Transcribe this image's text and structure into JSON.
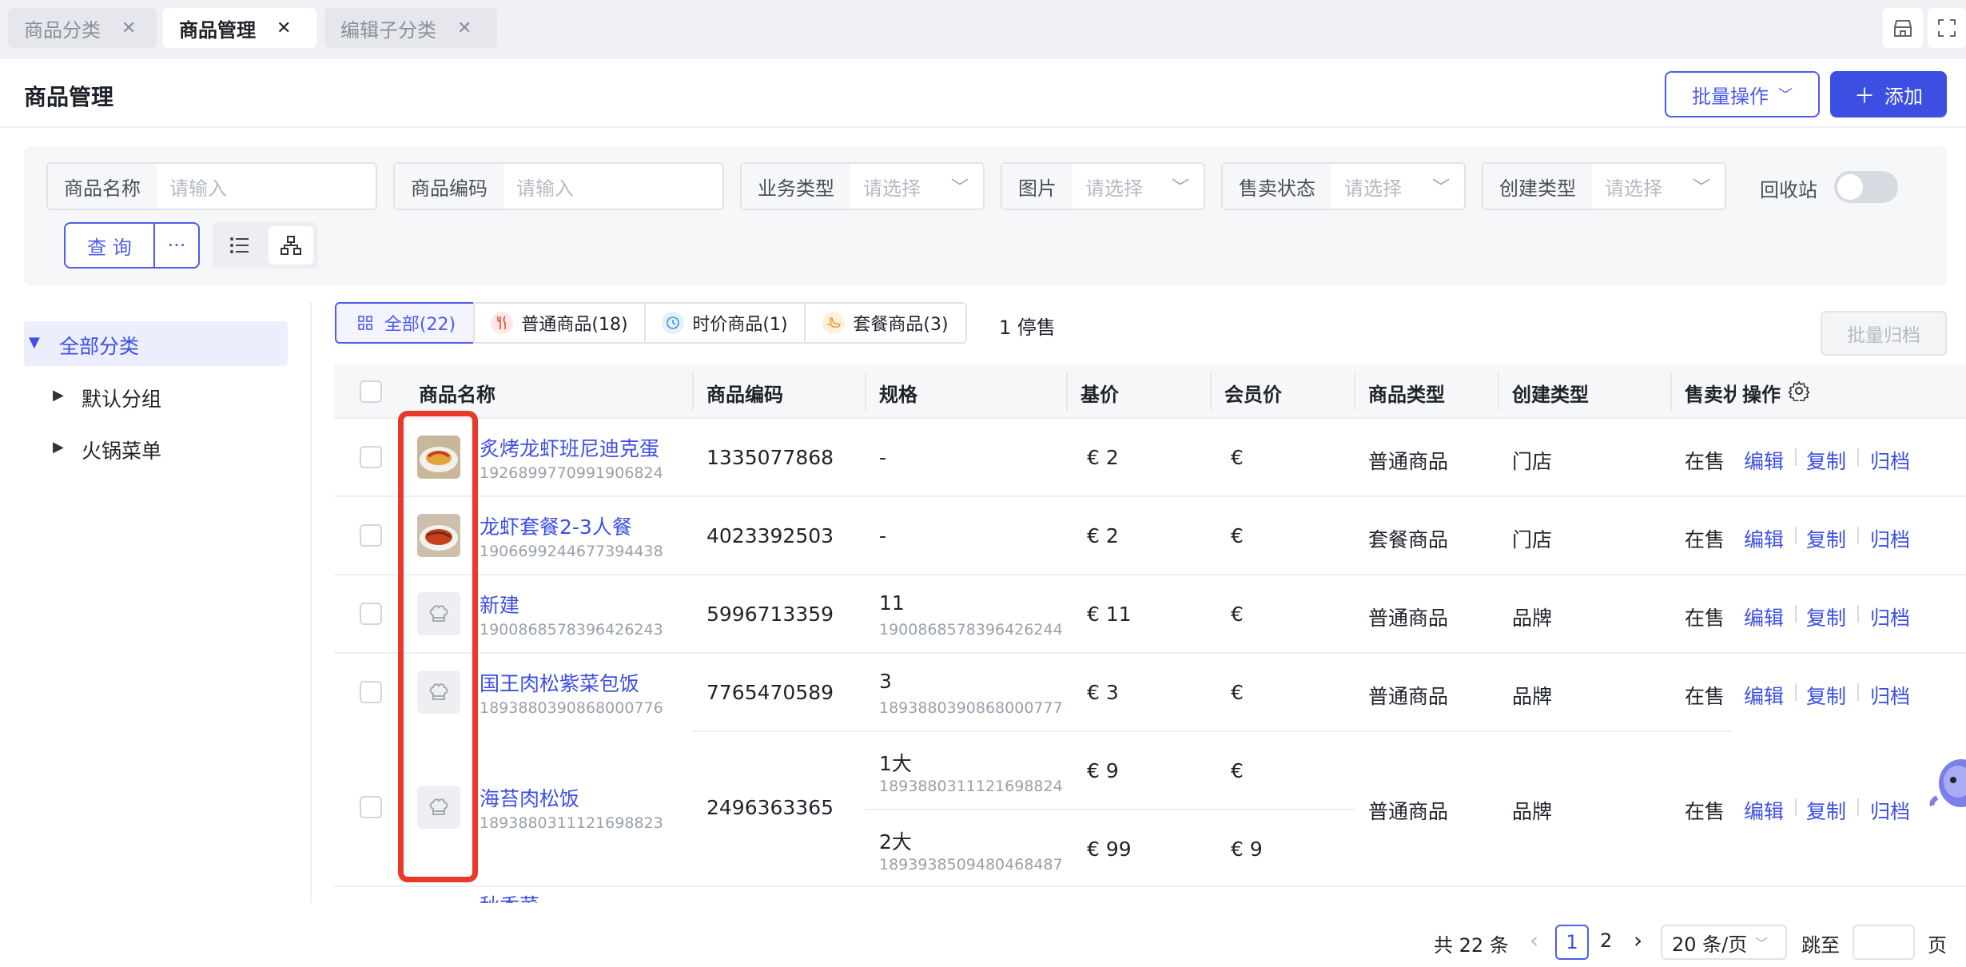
{
  "tabs": [
    {
      "label": "商品分类",
      "close": "✕"
    },
    {
      "label": "商品管理",
      "close": "✕"
    },
    {
      "label": "编辑子分类",
      "close": "✕"
    }
  ],
  "page": {
    "title": "商品管理",
    "batch_label": "批量操作",
    "add_label": "添加",
    "add_plus": "＋",
    "chevron": "﹀"
  },
  "filters": {
    "name": {
      "label": "商品名称",
      "placeholder": "请输入"
    },
    "code": {
      "label": "商品编码",
      "placeholder": "请输入"
    },
    "biz_type": {
      "label": "业务类型",
      "placeholder": "请选择"
    },
    "image": {
      "label": "图片",
      "placeholder": "请选择"
    },
    "sale_status": {
      "label": "售卖状态",
      "placeholder": "请选择"
    },
    "create_type": {
      "label": "创建类型",
      "placeholder": "请选择"
    },
    "recycle_label": "回收站",
    "recycle_on": false,
    "query_label": "查 询",
    "more_label": "···"
  },
  "tree": {
    "root": "全部分类",
    "children": [
      "默认分组",
      "火锅菜单"
    ]
  },
  "category_tabs": [
    {
      "label": "全部(22)",
      "icon": "grid-icon"
    },
    {
      "label": "普通商品(18)",
      "icon": "fork-knife-icon"
    },
    {
      "label": "时价商品(1)",
      "icon": "clock-icon"
    },
    {
      "label": "套餐商品(3)",
      "icon": "hand-icon"
    }
  ],
  "stopped_label": "1 停售",
  "batch_archive_label": "批量归档",
  "table": {
    "headers": [
      "商品名称",
      "商品编码",
      "规格",
      "基价",
      "会员价",
      "商品类型",
      "创建类型",
      "售卖状",
      "操作"
    ],
    "actions": [
      "编辑",
      "复制",
      "归档"
    ],
    "rows": [
      {
        "name": "炙烤龙虾班尼迪克蛋",
        "id": "1926899770991906824",
        "code": "1335077868",
        "spec": "-",
        "spec_id": "",
        "base": "€  2",
        "member": "€",
        "type": "普通商品",
        "create": "门店",
        "status": "在售"
      },
      {
        "name": "龙虾套餐2-3人餐",
        "id": "1906699244677394438",
        "code": "4023392503",
        "spec": "-",
        "spec_id": "",
        "base": "€  2",
        "member": "€",
        "type": "套餐商品",
        "create": "门店",
        "status": "在售"
      },
      {
        "name": "新建",
        "id": "1900868578396426243",
        "code": "5996713359",
        "spec": "11",
        "spec_id": "1900868578396426244",
        "base": "€  11",
        "member": "€",
        "type": "普通商品",
        "create": "品牌",
        "status": "在售"
      },
      {
        "name": "国王肉松紫菜包饭",
        "id": "1893880390868000776",
        "code": "7765470589",
        "spec": "3",
        "spec_id": "1893880390868000777",
        "base": "€  3",
        "member": "€",
        "type": "普通商品",
        "create": "品牌",
        "status": "在售"
      },
      {
        "name": "海苔肉松饭",
        "id": "1893880311121698823",
        "code": "2496363365",
        "spec": "1大",
        "spec_id": "1893880311121698824",
        "base": "€  9",
        "member": "€",
        "spec2": "2大",
        "spec2_id": "1893938509480468487",
        "base2": "€  99",
        "member2": "€  9",
        "type": "普通商品",
        "create": "品牌",
        "status": "在售"
      }
    ],
    "partial_row_name": "秋香菜"
  },
  "pagination": {
    "total": "共 22 条",
    "prev": "‹",
    "page1": "1",
    "page2": "2",
    "next": "›",
    "size": "20 条/页",
    "jump": "跳至",
    "page_suffix": "页"
  },
  "colors": {
    "accent": "#3d4fe3",
    "highlight": "#e8392a"
  }
}
